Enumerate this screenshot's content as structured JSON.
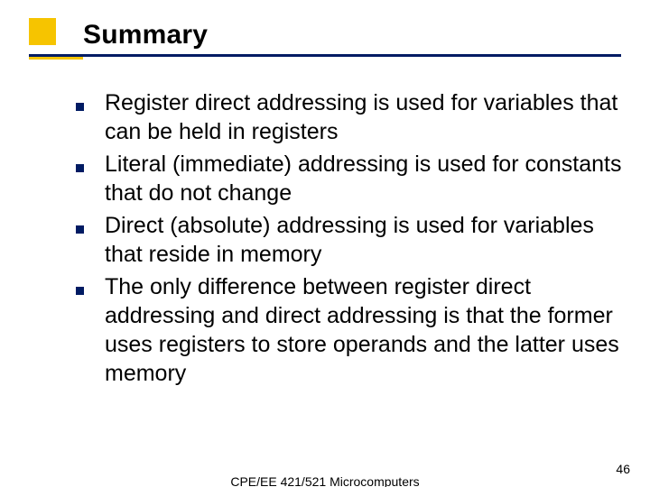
{
  "title": "Summary",
  "bullets": [
    "Register direct addressing is used for variables that can be held in registers",
    "Literal (immediate) addressing is used for constants that do not change",
    "Direct (absolute) addressing is used for variables that reside in memory",
    "The only difference between register direct addressing and direct addressing is that the former uses registers to store operands and the latter uses memory"
  ],
  "footer": {
    "course": "CPE/EE 421/521 Microcomputers",
    "page": "46"
  },
  "colors": {
    "accent": "#f6c400",
    "rule": "#001b63",
    "bullet": "#001b63"
  }
}
